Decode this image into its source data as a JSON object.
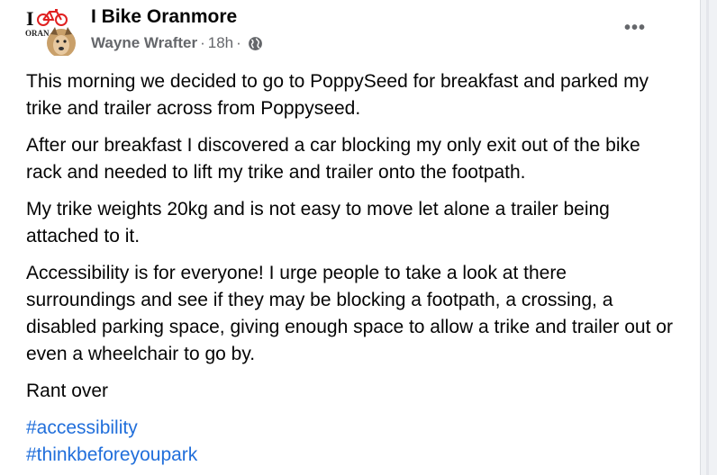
{
  "post": {
    "group_name": "I Bike Oranmore",
    "author": "Wayne Wrafter",
    "separator": "·",
    "time": "18h",
    "privacy_icon": "globe-icon",
    "more_label": "•••",
    "avatar": {
      "letter": "I",
      "text": "ORAN",
      "bike_color": "#e02020"
    },
    "paragraphs": [
      "This morning we decided to go to PoppySeed for breakfast and parked my trike and trailer across from Poppyseed.",
      "After our breakfast I discovered a car blocking my only exit out of the bike rack and needed to lift my trike and trailer onto the footpath.",
      "My trike weights 20kg and is not easy to move let alone a trailer being attached to it.",
      "Accessibility is for everyone! I urge people to take a look at there surroundings and see if they may be blocking a footpath, a crossing, a disabled parking space, giving enough space to allow a trike and trailer out or even a wheelchair to go by.",
      "Rant over"
    ],
    "hashtags": [
      "#accessibility",
      "#thinkbeforeyoupark"
    ],
    "link_color": "#216fdb"
  }
}
